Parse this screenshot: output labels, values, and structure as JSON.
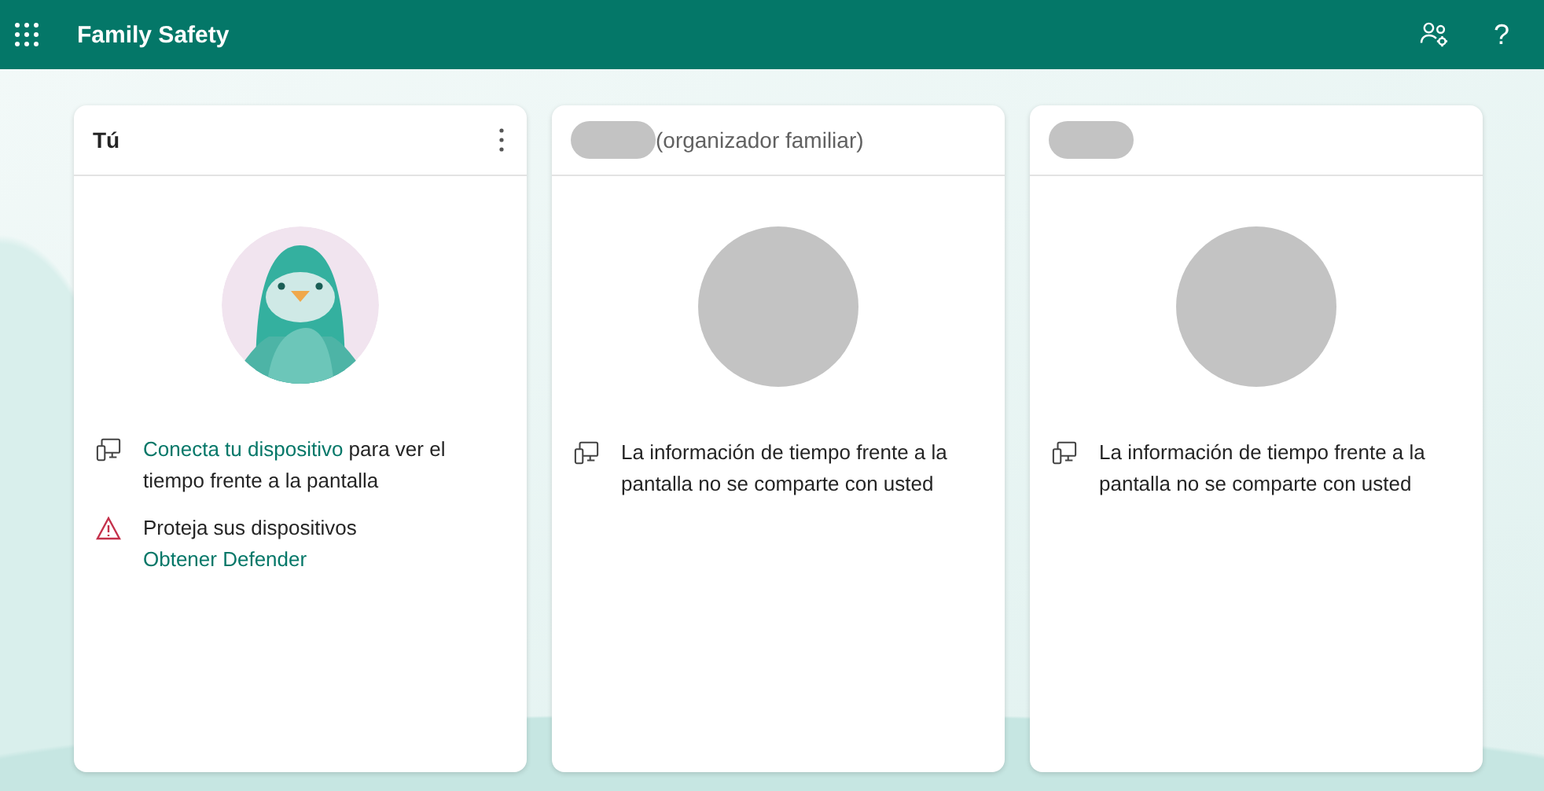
{
  "app": {
    "title": "Family Safety",
    "help": "?"
  },
  "cards": [
    {
      "kind": "self",
      "title": "Tú",
      "name_redacted": false,
      "more_menu": true,
      "items": [
        {
          "kind": "device",
          "link": "Conecta tu dispositivo",
          "text": " para ver el tiempo frente a la pantalla"
        },
        {
          "kind": "warning",
          "text": "Proteja sus dispositivos",
          "link": "Obtener Defender"
        }
      ]
    },
    {
      "kind": "member",
      "title": "(organizador familiar)",
      "name_redacted": true,
      "more_menu": false,
      "items": [
        {
          "kind": "device",
          "text": "La información de tiempo frente a la pantalla no se comparte con usted"
        }
      ]
    },
    {
      "kind": "member",
      "name_redacted": true,
      "more_menu": false,
      "items": [
        {
          "kind": "device",
          "text": "La información de tiempo frente a la pantalla no se comparte con usted"
        }
      ]
    }
  ]
}
